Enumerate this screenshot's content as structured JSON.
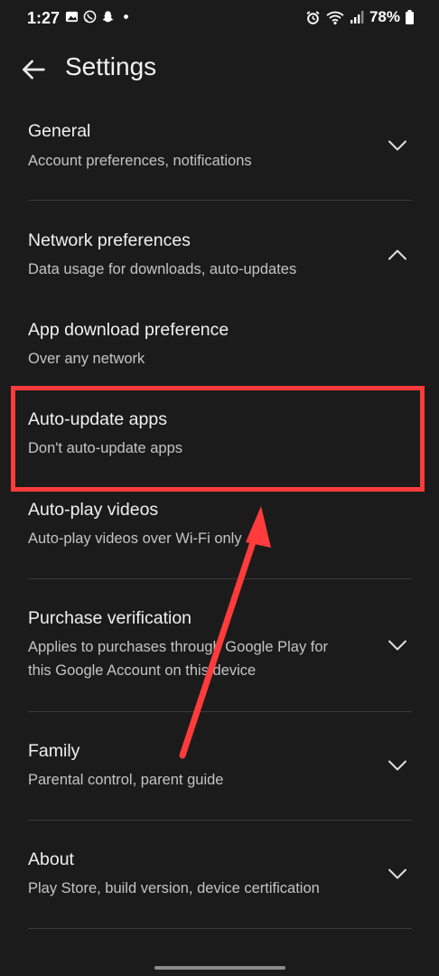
{
  "status_bar": {
    "time": "1:27",
    "battery": "78%",
    "left_icons": [
      "gallery-icon",
      "whatsapp-icon",
      "snapchat-icon",
      "notification-dot-icon"
    ],
    "right_icons": [
      "alarm-icon",
      "wifi-icon",
      "signal-icon",
      "battery-icon"
    ]
  },
  "app_bar": {
    "title": "Settings",
    "back_icon": "arrow-back-icon"
  },
  "sections": [
    {
      "title": "General",
      "subtitle": "Account preferences, notifications",
      "chevron": "chevron-down-icon"
    },
    {
      "title": "Network preferences",
      "subtitle": "Data usage for downloads, auto-updates",
      "chevron": "chevron-up-icon"
    },
    {
      "title": "App download preference",
      "subtitle": "Over any network"
    },
    {
      "title": "Auto-update apps",
      "subtitle": "Don't auto-update apps"
    },
    {
      "title": "Auto-play videos",
      "subtitle": "Auto-play videos over Wi-Fi only"
    },
    {
      "title": "Purchase verification",
      "subtitle_line1": "Applies to purchases through Google Play for",
      "subtitle_line2": "this Google Account on this device",
      "chevron": "chevron-down-icon"
    },
    {
      "title": "Family",
      "subtitle": "Parental control, parent guide",
      "chevron": "chevron-down-icon"
    },
    {
      "title": "About",
      "subtitle": "Play Store, build version, device certification",
      "chevron": "chevron-down-icon"
    }
  ],
  "colors": {
    "background": "#1b1b1b",
    "annotation": "#ff3b3b",
    "divider": "#3b3b3b"
  }
}
